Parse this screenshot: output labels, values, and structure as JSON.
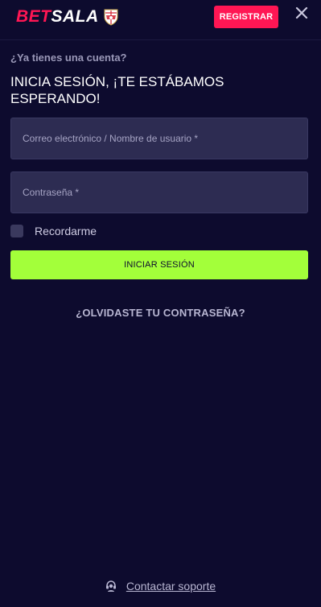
{
  "header": {
    "logo_part1": "BET",
    "logo_part2": "SALA",
    "register_label": "REGISTRAR",
    "close_icon": "close-icon"
  },
  "login": {
    "have_account": "¿Ya tienes una cuenta?",
    "title": "INICIA SESIÓN, ¡TE ESTÁBAMOS ESPERANDO!",
    "email_placeholder": "Correo electrónico / Nombre de usuario *",
    "email_value": "",
    "password_placeholder": "Contraseña *",
    "password_value": "",
    "remember_label": "Recordarme",
    "remember_checked": false,
    "submit_label": "INICIAR SESIÓN",
    "forgot_label": "¿OLVIDASTE TU CONTRASEÑA?"
  },
  "footer": {
    "support_label": "Contactar soporte",
    "support_icon": "headset-icon"
  },
  "colors": {
    "background": "#0d0b2e",
    "brand_red": "#ff1654",
    "accent_green": "#a3ff3a",
    "input_bg": "#2d2c52"
  }
}
